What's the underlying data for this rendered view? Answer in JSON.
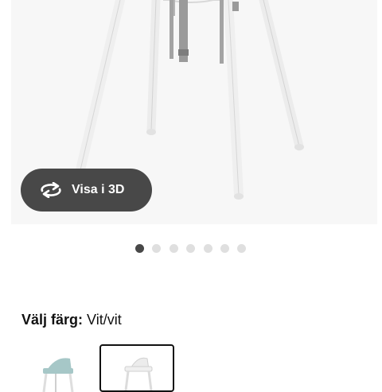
{
  "view3d": {
    "label": "Visa i 3D",
    "icon": "rotate-3d-icon"
  },
  "carousel": {
    "total": 7,
    "active_index": 0
  },
  "color_selector": {
    "heading": "Välj färg:",
    "selected_value": "Vit/vit",
    "swatches": [
      {
        "name": "turquoise-white",
        "color": "#a6c7c7",
        "selected": false
      },
      {
        "name": "white-white",
        "color": "#f2f2f2",
        "selected": true
      }
    ]
  },
  "colors": {
    "accent_dark": "#484848",
    "dot_inactive": "#dfdfdf"
  }
}
